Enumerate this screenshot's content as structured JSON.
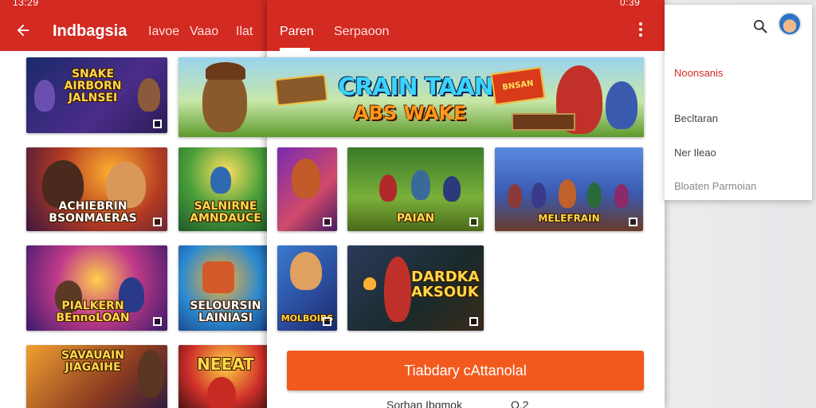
{
  "status": {
    "time": "13:29",
    "right": "0:39"
  },
  "left_panel": {
    "title": "Indbagsia",
    "tabs": [
      "Iavoe",
      "Vaao",
      "Ilat"
    ],
    "thumbs": [
      {
        "caption": "SNAKE\nAIRBORN\nJALNSEI"
      },
      {
        "caption": "ACHIEBRIN\nBSONMAERAS"
      },
      {
        "caption": "SALNIRNE\nAMNDAUCE"
      },
      {
        "caption": "PIALKERN\nBEnnoLOAN"
      },
      {
        "caption": "SELOURSIN\nLAINIASI"
      },
      {
        "caption": "SAVAUAIN\nJIAGAIHE"
      },
      {
        "caption": "NEEAT"
      }
    ]
  },
  "center_panel": {
    "tabs": [
      "Paren",
      "Serpaoon"
    ],
    "banner": {
      "title": "CRAIN TAAN",
      "subtitle": "ABS WAKE",
      "badge": "BNSAN"
    },
    "thumbs": [
      {
        "caption": ""
      },
      {
        "caption": "PAIAN"
      },
      {
        "caption": "MELEFRAIN"
      },
      {
        "caption": "MOLBOIRS"
      },
      {
        "caption": "DARDKA\nAKSOUK"
      }
    ],
    "button_label": "Tiabdary cAttanolal",
    "bottom_text": "Sorhan Ibqmok",
    "bottom_right_text": "O.2"
  },
  "right_panel": {
    "menu": [
      {
        "label": "Noonsanis",
        "active": true
      },
      {
        "label": "Becltaran",
        "active": false
      },
      {
        "label": "Ner Ileao",
        "active": false
      },
      {
        "label": "Bloaten Parmoian",
        "active": false,
        "dim": true
      }
    ]
  }
}
